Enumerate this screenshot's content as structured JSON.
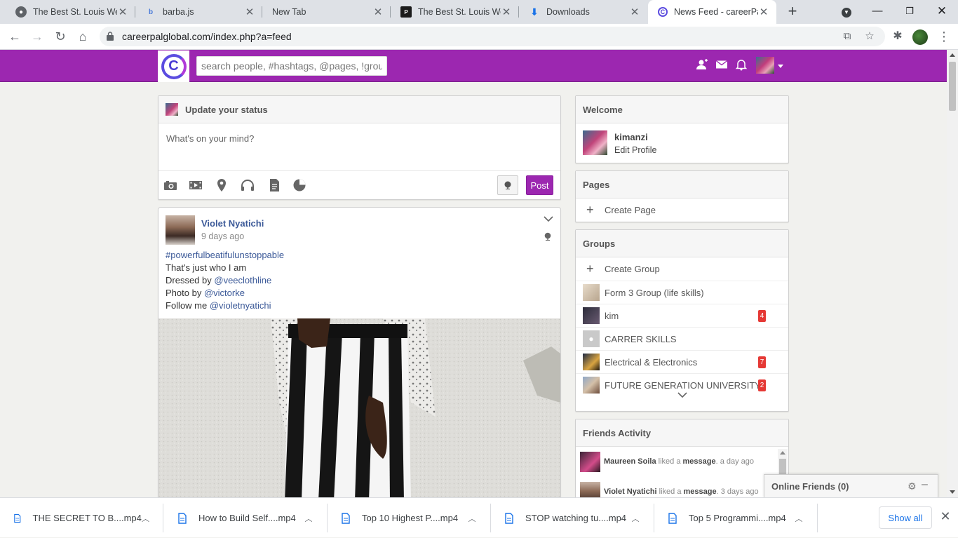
{
  "browser": {
    "tabs": [
      {
        "title": "The Best St. Louis Web",
        "icon": "globe-icon"
      },
      {
        "title": "barba.js",
        "icon": "barba-icon"
      },
      {
        "title": "New Tab",
        "icon": ""
      },
      {
        "title": "The Best St. Louis Web",
        "icon": "site-icon"
      },
      {
        "title": "Downloads",
        "icon": "download-icon"
      },
      {
        "title": "News Feed - careerPal",
        "icon": "careerpal-icon",
        "active": true
      }
    ],
    "url": "careerpalglobal.com/index.php?a=feed"
  },
  "header": {
    "search_placeholder": "search people, #hashtags, @pages, !groups",
    "accent": "#9c27b0"
  },
  "status": {
    "title": "Update your status",
    "placeholder": "What's on your mind?",
    "post_label": "Post"
  },
  "post": {
    "author": "Violet Nyatichi",
    "time": "9 days ago",
    "lines": [
      {
        "text": "#powerfulbeatifulunstoppable"
      },
      {
        "text": "That's just who I am"
      },
      {
        "prefix": "Dressed by ",
        "link": "@veeclothline"
      },
      {
        "prefix": "Photo by ",
        "link": "@victorke"
      },
      {
        "prefix": "Follow me ",
        "link": "@violetnyatichi"
      }
    ]
  },
  "welcome": {
    "title": "Welcome",
    "name": "kimanzi",
    "edit": "Edit Profile"
  },
  "pages": {
    "title": "Pages",
    "create": "Create Page"
  },
  "groups": {
    "title": "Groups",
    "create": "Create Group",
    "items": [
      {
        "name": "Form 3 Group (life skills)",
        "badge": ""
      },
      {
        "name": "kim",
        "badge": "4"
      },
      {
        "name": "CARRER SKILLS",
        "badge": ""
      },
      {
        "name": "Electrical & Electronics",
        "badge": "7"
      },
      {
        "name": "FUTURE GENERATION UNIVERSITY",
        "badge": "2"
      }
    ]
  },
  "activity": {
    "title": "Friends Activity",
    "items": [
      {
        "user": "Maureen Soila",
        "verb": " liked a ",
        "object": "message",
        "time": ". a day ago"
      },
      {
        "user": "Violet Nyatichi",
        "verb": " liked a ",
        "object": "message",
        "time": ". 3 days ago"
      }
    ]
  },
  "online": {
    "title": "Online Friends (0)"
  },
  "downloads": {
    "items": [
      "THE SECRET TO B....mp4",
      "How to Build Self....mp4",
      "Top 10 Highest P....mp4",
      "STOP watching tu....mp4",
      "Top 5 Programmi....mp4"
    ],
    "show_all": "Show all"
  }
}
